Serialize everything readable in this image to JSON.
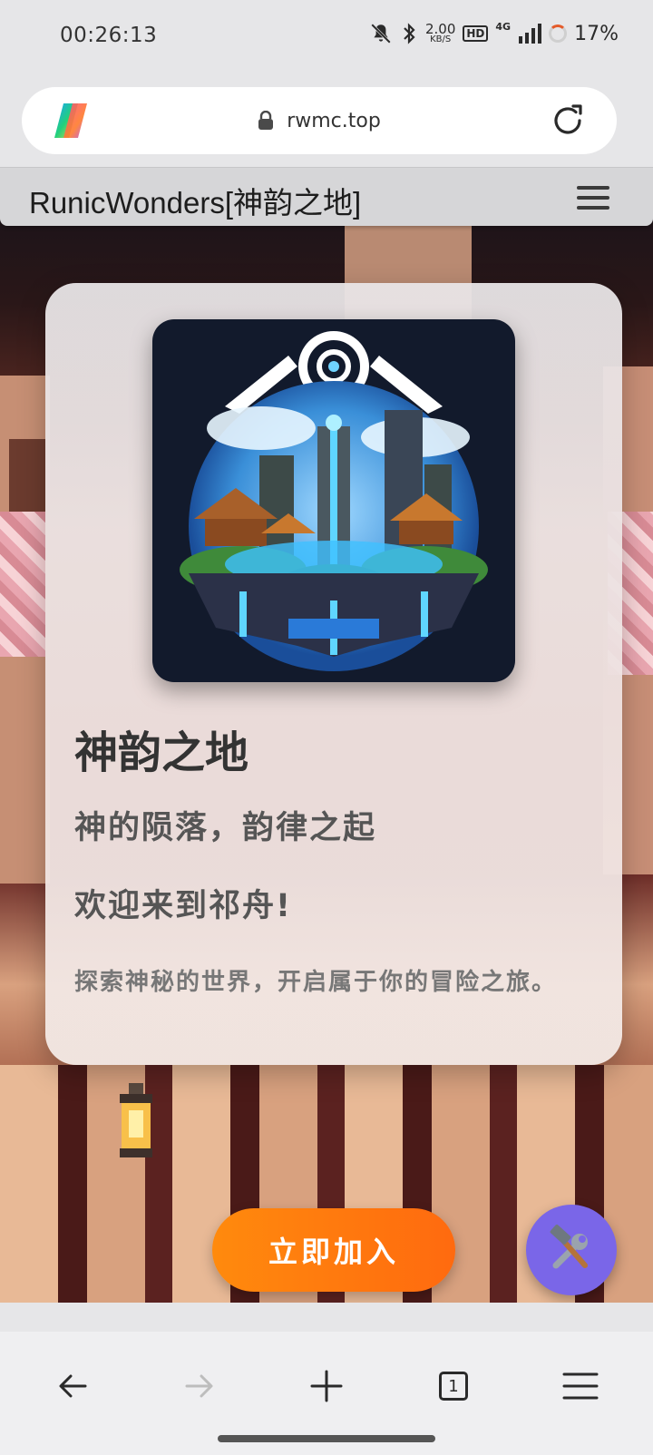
{
  "status_bar": {
    "time": "00:26:13",
    "net_speed_value": "2.00",
    "net_speed_unit": "KB/S",
    "hd_label": "HD",
    "network_label": "4G",
    "battery": "17%"
  },
  "browser": {
    "url": "rwmc.top"
  },
  "site": {
    "header_title": "RunicWonders[神韵之地]"
  },
  "card": {
    "title": "神韵之地",
    "subtitle": "神的陨落，韵律之起",
    "welcome": "欢迎来到祁舟!",
    "description": "探索神秘的世界，开启属于你的冒险之旅。"
  },
  "actions": {
    "join_label": "立即加入"
  },
  "bottom_nav": {
    "tab_count": "1"
  },
  "colors": {
    "accent": "#ff7a0f",
    "fab": "#7a66e8"
  }
}
